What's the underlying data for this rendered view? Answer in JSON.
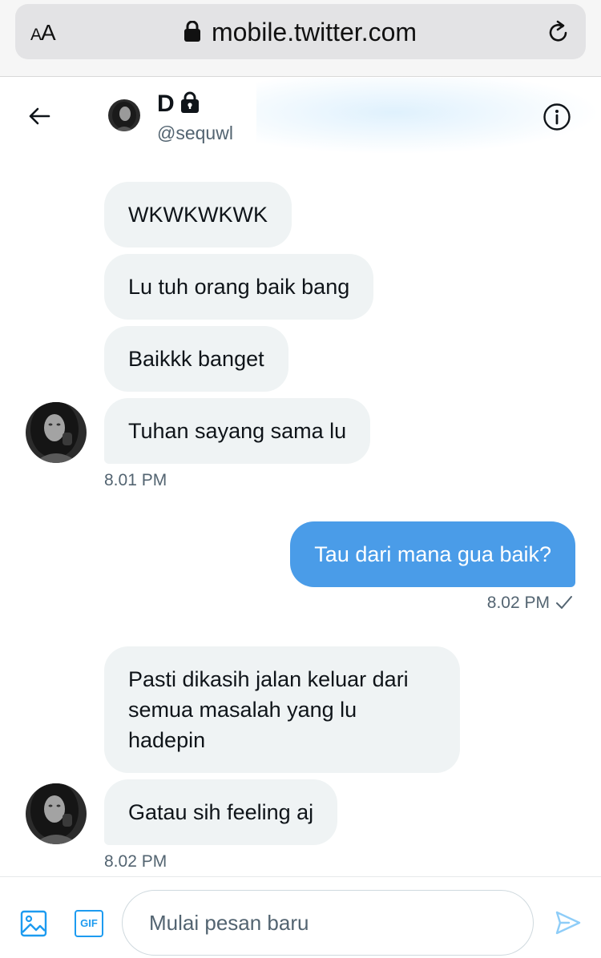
{
  "browser": {
    "aa_label_small": "A",
    "aa_label_large": "A",
    "url": "mobile.twitter.com"
  },
  "header": {
    "name": "D",
    "handle": "@sequwl"
  },
  "messages": {
    "group1": [
      "WKWKWKWK",
      "Lu tuh orang baik bang",
      "Baikkk banget",
      "Tuhan sayang sama lu"
    ],
    "group1_time": "8.01 PM",
    "sent": "Tau dari mana gua baik?",
    "sent_time": "8.02 PM",
    "group2_first_lines": [
      "Pasti dikasih jalan keluar dari",
      "semua masalah yang lu",
      "hadepin"
    ],
    "group2_second": "Gatau sih feeling aj",
    "group2_time": "8.02 PM"
  },
  "composer": {
    "placeholder": "Mulai pesan baru",
    "gif_label": "GIF"
  },
  "colors": {
    "accent": "#1d9bf0",
    "sent_bubble": "#4a9ce8",
    "received_bubble": "#eff3f4",
    "secondary_text": "#536471"
  },
  "icons": [
    "lock-icon",
    "reload-icon",
    "back-arrow-icon",
    "info-icon",
    "verified-lock-icon",
    "check-icon",
    "image-icon",
    "gif-icon",
    "send-icon"
  ]
}
